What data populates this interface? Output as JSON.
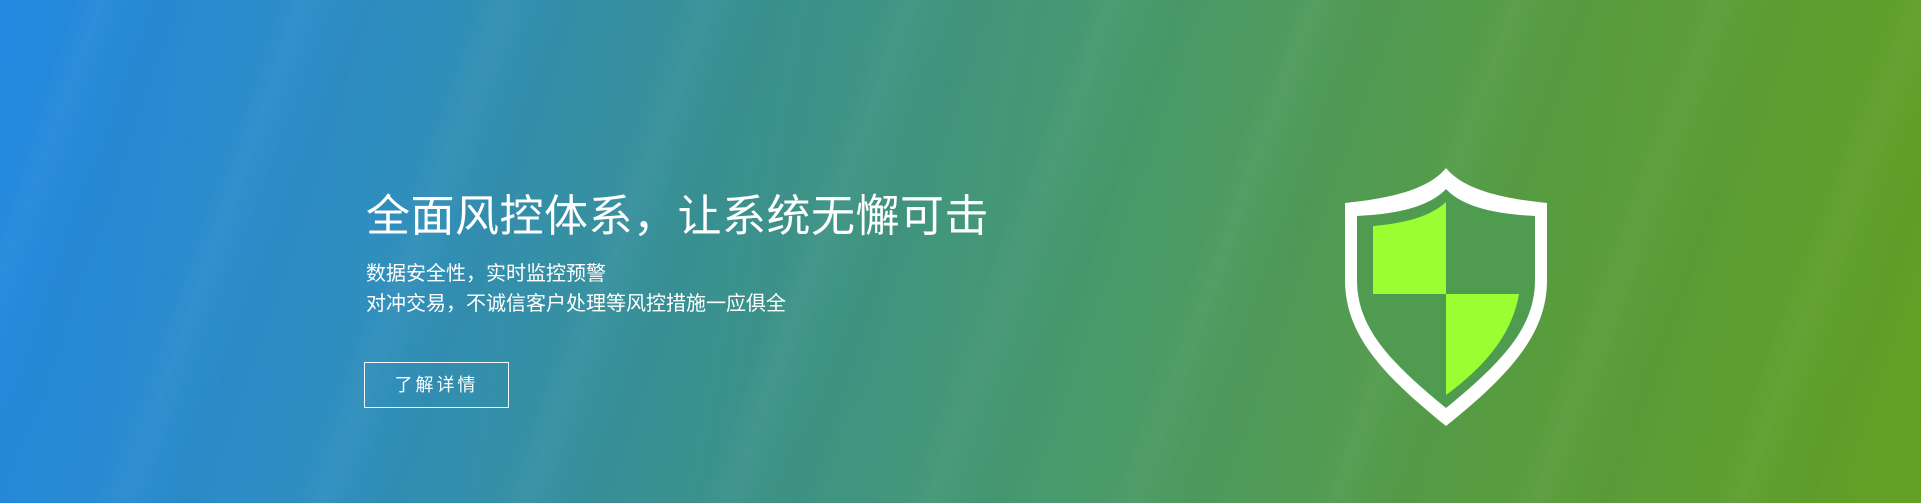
{
  "hero": {
    "headline": "全面风控体系，让系统无懈可击",
    "subtitle_lines": [
      "数据安全性，实时监控预警",
      "对冲交易，不诚信客户处理等风控措施一应俱全"
    ],
    "cta_label": "了解详情"
  },
  "icons": {
    "hero_graphic": "shield-check-icon"
  },
  "colors": {
    "gradient_start": "#2388e0",
    "gradient_end": "#63a024",
    "shield_outline": "#ffffff",
    "shield_fill": "#99ff33",
    "shield_dark": "#4f9c50"
  }
}
